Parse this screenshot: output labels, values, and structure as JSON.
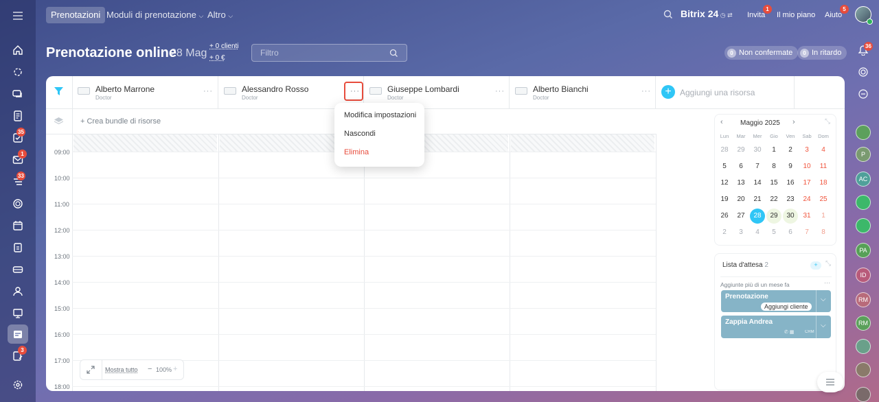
{
  "topnav": {
    "tab_active": "Prenotazioni",
    "tab_modules": "Moduli di prenotazione",
    "tab_more": "Altro"
  },
  "topbar": {
    "brand": "Bitrix",
    "brand_num": "24",
    "invite": "Invita",
    "invite_badge": "1",
    "plan": "Il mio piano",
    "help": "Aiuto",
    "help_badge": "5"
  },
  "rail_badges": {
    "tasks": "35",
    "mail": "1",
    "feed": "33",
    "approvals": "3"
  },
  "right_badges": {
    "notifications": "36"
  },
  "right_avatars": [
    "P",
    "AC",
    "PA",
    "ID",
    "RM",
    "RM"
  ],
  "header": {
    "title": "Prenotazione online",
    "date": "28 Mag",
    "clients": "+ 0 clienti",
    "amount": "+ 0 €",
    "filter_placeholder": "Filtro",
    "unconfirmed_count": "0",
    "unconfirmed": "Non confermate",
    "late_count": "0",
    "late": "In ritardo"
  },
  "resources": [
    {
      "name": "Alberto Marrone",
      "role": "Doctor"
    },
    {
      "name": "Alessandro Rosso",
      "role": "Doctor"
    },
    {
      "name": "Giuseppe Lombardi",
      "role": "Doctor"
    },
    {
      "name": "Alberto Bianchi",
      "role": "Doctor"
    }
  ],
  "add_resource": "Aggiungi una risorsa",
  "bundle": "+ Crea bundle di risorse",
  "hours": [
    "09:00",
    "10:00",
    "11:00",
    "12:00",
    "13:00",
    "14:00",
    "15:00",
    "16:00",
    "17:00",
    "18:00"
  ],
  "zoom": {
    "show_all": "Mostra tutto",
    "level": "100%",
    "minus": "−",
    "plus": "+"
  },
  "menu": {
    "edit": "Modifica impostazioni",
    "hide": "Nascondi",
    "delete": "Elimina"
  },
  "calendar": {
    "month": "Maggio 2025",
    "days": [
      "Lun",
      "Mar",
      "Mer",
      "Gio",
      "Ven",
      "Sab",
      "Dom"
    ],
    "weeks": [
      [
        "28",
        "29",
        "30",
        "1",
        "2",
        "3",
        "4"
      ],
      [
        "5",
        "6",
        "7",
        "8",
        "9",
        "10",
        "11"
      ],
      [
        "12",
        "13",
        "14",
        "15",
        "16",
        "17",
        "18"
      ],
      [
        "19",
        "20",
        "21",
        "22",
        "23",
        "24",
        "25"
      ],
      [
        "26",
        "27",
        "28",
        "29",
        "30",
        "31",
        "1"
      ],
      [
        "2",
        "3",
        "4",
        "5",
        "6",
        "7",
        "8"
      ]
    ],
    "selected": "28"
  },
  "waitlist": {
    "title": "Lista d'attesa",
    "count": "2",
    "subtitle": "Aggiunte più di un mese fa",
    "cards": [
      {
        "name": "Prenotazione",
        "action": "Aggiungi cliente"
      },
      {
        "name": "Zappia Andrea",
        "tag": "CRM"
      }
    ]
  },
  "colors": {
    "accent": "#2fc6f6",
    "danger": "#e74c3c",
    "weekend": "#f0543c",
    "waitlist": "#86b4c7"
  }
}
